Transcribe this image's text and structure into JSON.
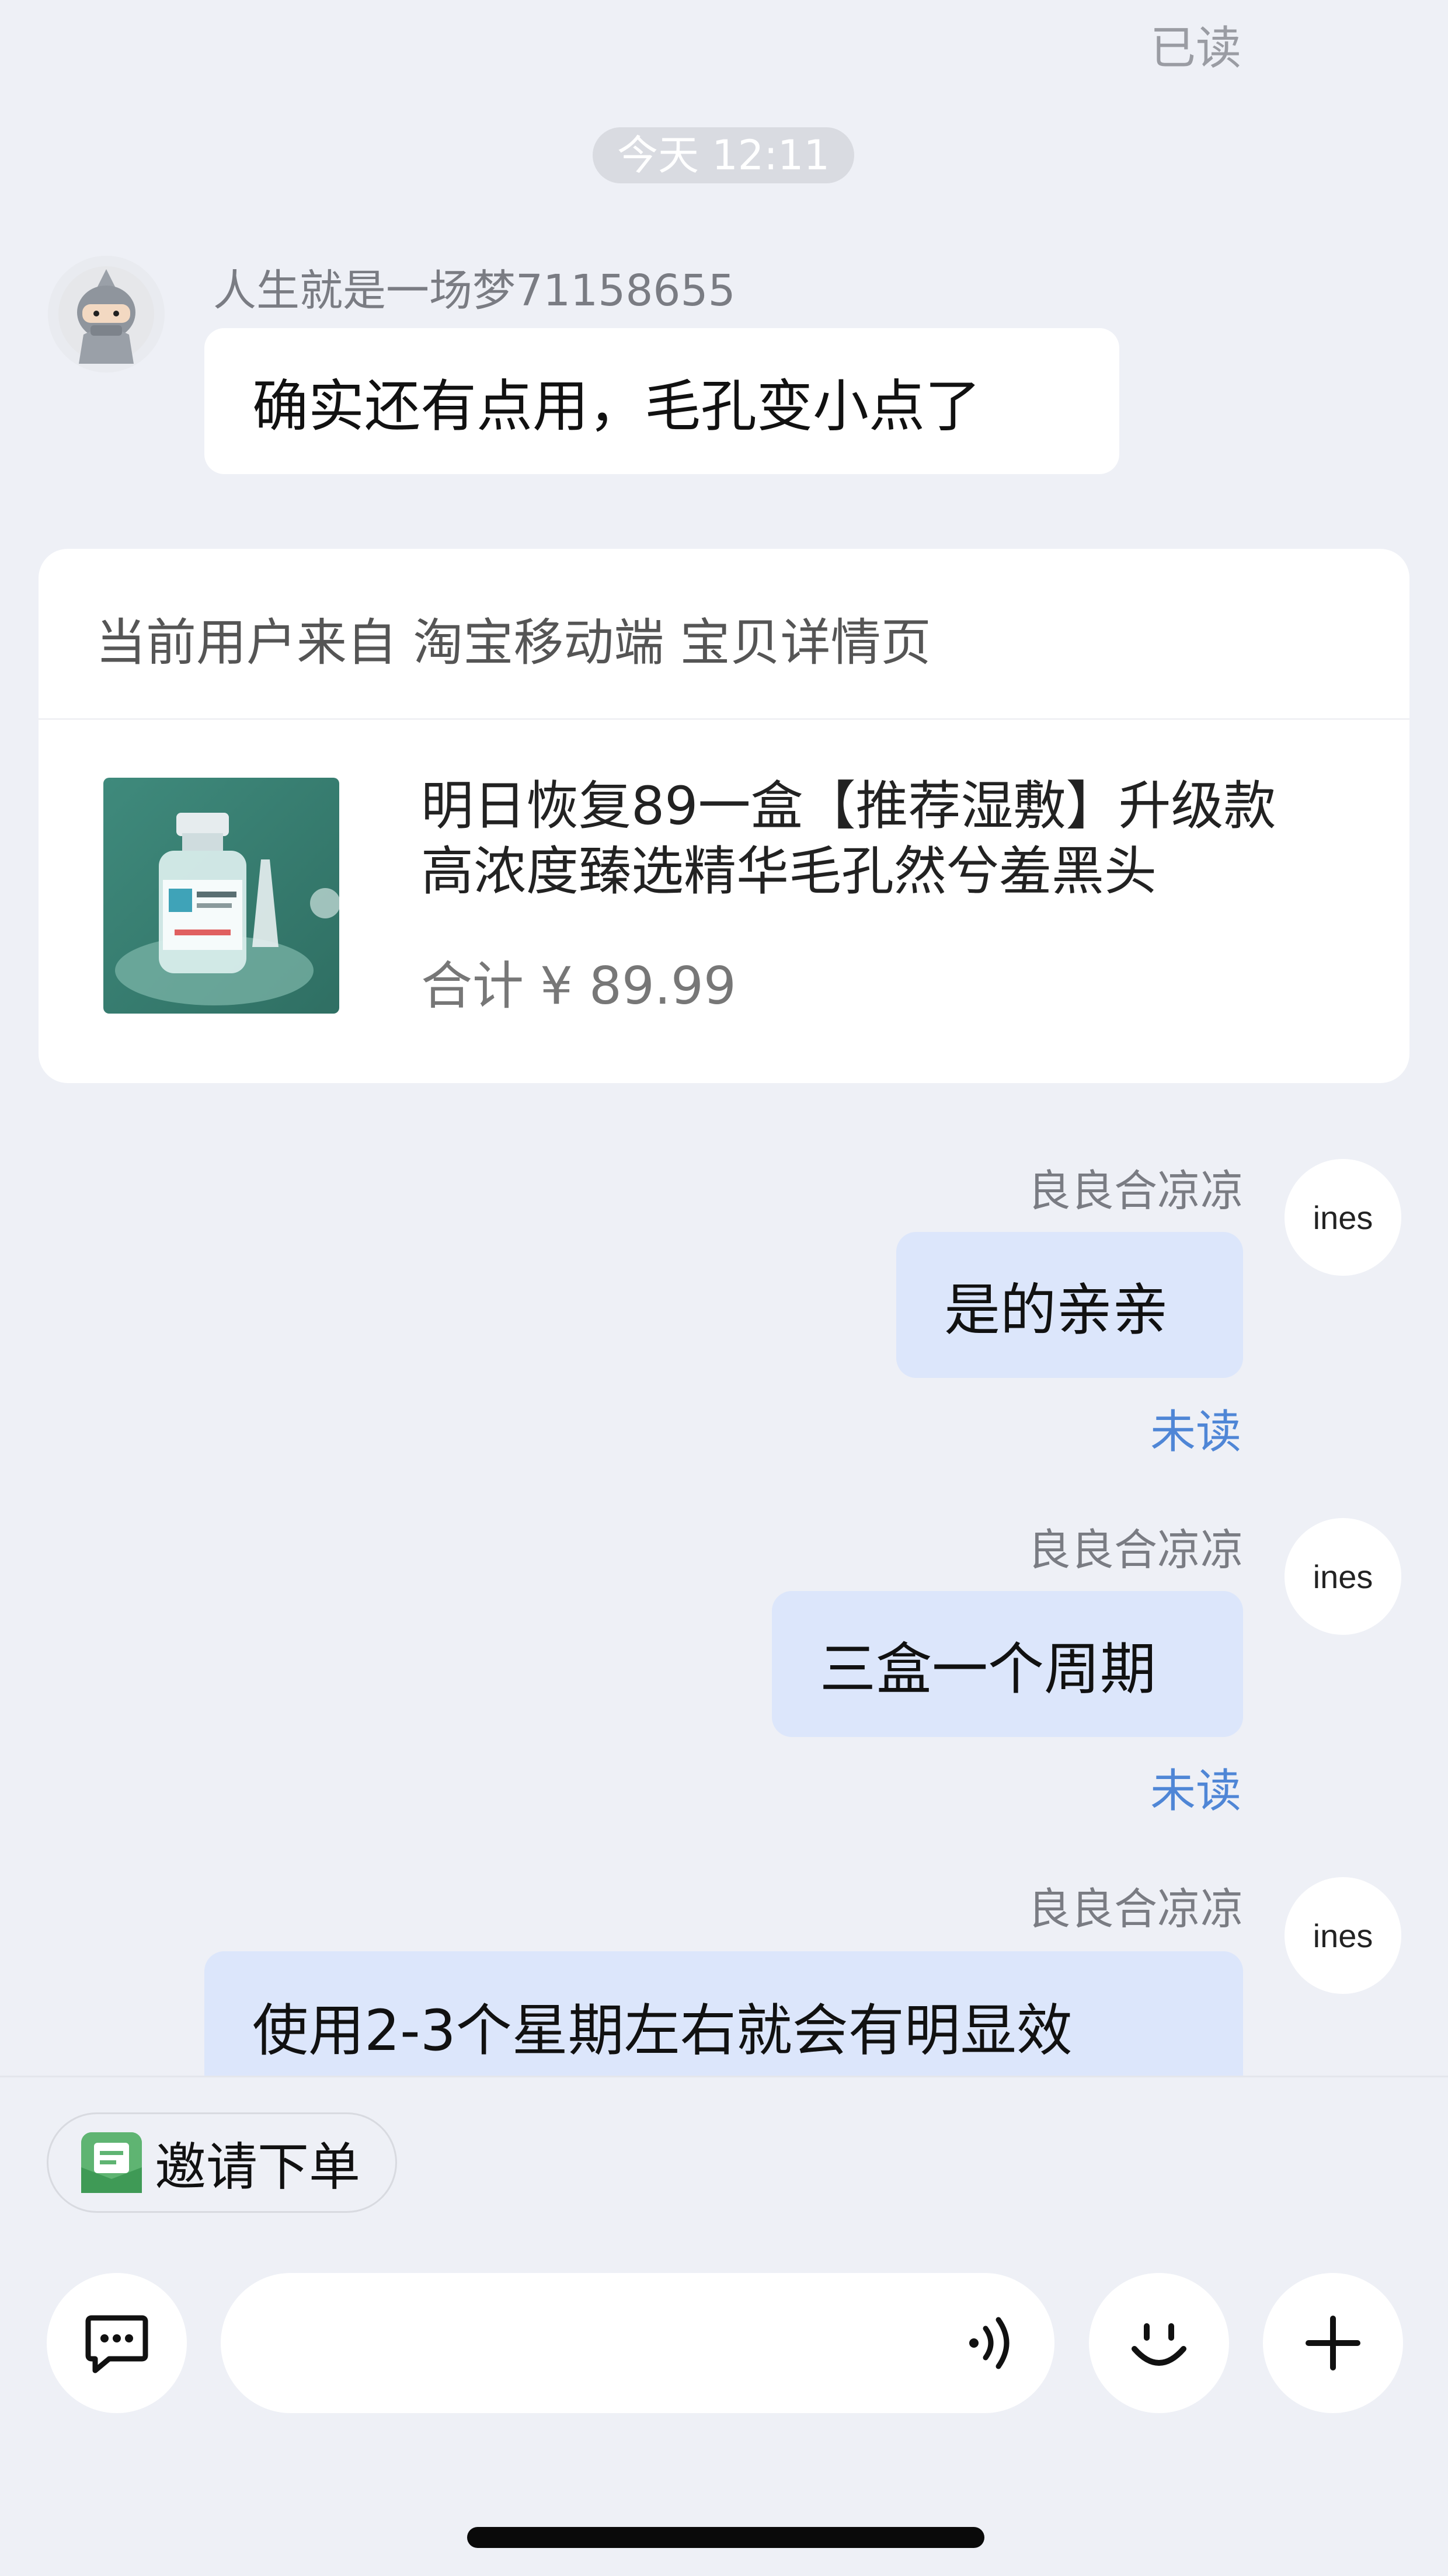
{
  "chat": {
    "top_read_status": "已读",
    "time_divider": "今天 12:11",
    "incoming": {
      "sender": "人生就是一场梦71158655",
      "text": "确实还有点用，毛孔变小点了"
    },
    "product_card": {
      "source": "当前用户来自 淘宝移动端 宝贝详情页",
      "title_line1": "明日恢复89一盒【推荐湿敷】升级款",
      "title_line2": "高浓度臻选精华毛孔然兮羞黑头",
      "total": "合计 ¥ 89.99"
    },
    "outgoing": [
      {
        "sender": "良良合凉凉",
        "avatar": "ines",
        "text": "是的亲亲",
        "status": "未读"
      },
      {
        "sender": "良良合凉凉",
        "avatar": "ines",
        "text": "三盒一个周期",
        "status": "未读"
      },
      {
        "sender": "良良合凉凉",
        "avatar": "ines",
        "text": "使用2-3个星期左右就会有明显效"
      }
    ]
  },
  "bottom": {
    "invite_chip": "邀请下单"
  },
  "icons": {
    "chat_mode": "message-square-icon",
    "voice": "voice-wave-icon",
    "emoji": "smile-icon",
    "more": "plus-icon",
    "invite": "order-invite-icon"
  },
  "colors": {
    "background": "#eef0f6",
    "outgoing_bubble": "#dce6fb",
    "incoming_bubble": "#ffffff",
    "unread_status": "#4f86d6",
    "invite_icon": "#5fb472"
  }
}
